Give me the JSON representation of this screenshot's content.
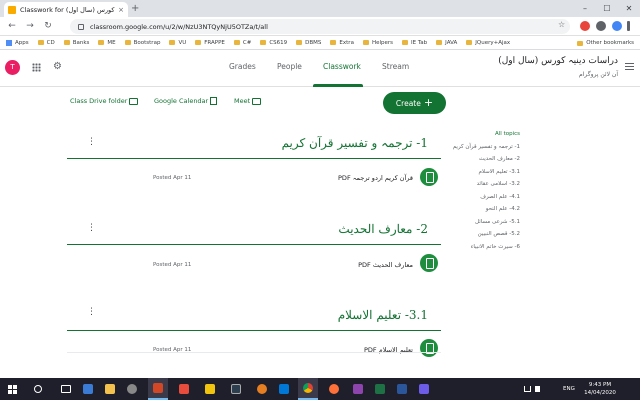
{
  "browser": {
    "tab_title": "Classwork for (سال اول) دینیہ کورس",
    "tab_close": "×",
    "new_tab": "+",
    "url": "classroom.google.com/u/2/w/NzU3NTQyNjU5OTZa/t/all",
    "win_min": "–",
    "win_max": "☐",
    "win_close": "✕",
    "back": "←",
    "forward": "→",
    "reload": "↻",
    "star": "☆"
  },
  "bookmarks": {
    "items": [
      "Apps",
      "CD",
      "Banks",
      "ME",
      "Bootstrap",
      "VU",
      "FRAPPE",
      "C#",
      "CS619",
      "DBMS",
      "Extra",
      "Helpers",
      "IE Tab",
      "JAVA",
      "JQuery+Ajax"
    ],
    "other": "Other bookmarks"
  },
  "header": {
    "avatar_letter": "T",
    "tabs": [
      "Grades",
      "People",
      "Classwork",
      "Stream"
    ],
    "class_name": "دراسات دینیہ کورس (سال اول)",
    "class_sub": "آن لائن پروگرام"
  },
  "toolbar": {
    "drive": "Class Drive folder",
    "calendar": "Google Calendar",
    "meet": "Meet",
    "create": "Create",
    "create_plus": "+"
  },
  "topics": [
    {
      "title": "1- ترجمہ و تفسیر قرآن کریم",
      "material": "قرآن کریم اردو ترجمہ PDF",
      "posted": "Posted Apr 11"
    },
    {
      "title": "2- معارف الحدیث",
      "material": "معارف الحدیث PDF",
      "posted": "Posted Apr 11"
    },
    {
      "title": "3.1- تعلیم الاسلام",
      "material": "تعلیم الاسلام PDF",
      "posted": "Posted Apr 11"
    }
  ],
  "kebab": "⋮",
  "side_topics": [
    "All topics",
    "1- ترجمہ و تفسیر قرآن کریم",
    "2- معارف الحدیث",
    "3.1- تعلیم الاسلام",
    "3.2- اسلامی عقائد",
    "4.1- علم الصرف",
    "4.2- علم النحو",
    "5.1- شرعی مسائل",
    "5.2- قصص النبیین",
    "6- سیرت خاتم الانبیاء"
  ],
  "taskbar": {
    "lang": "ENG",
    "time": "9:43 PM",
    "date": "14/04/2020"
  },
  "colors": {
    "accent": "#137333",
    "avatar": "#e91e63",
    "icon_bg": "#1e8e3e"
  }
}
